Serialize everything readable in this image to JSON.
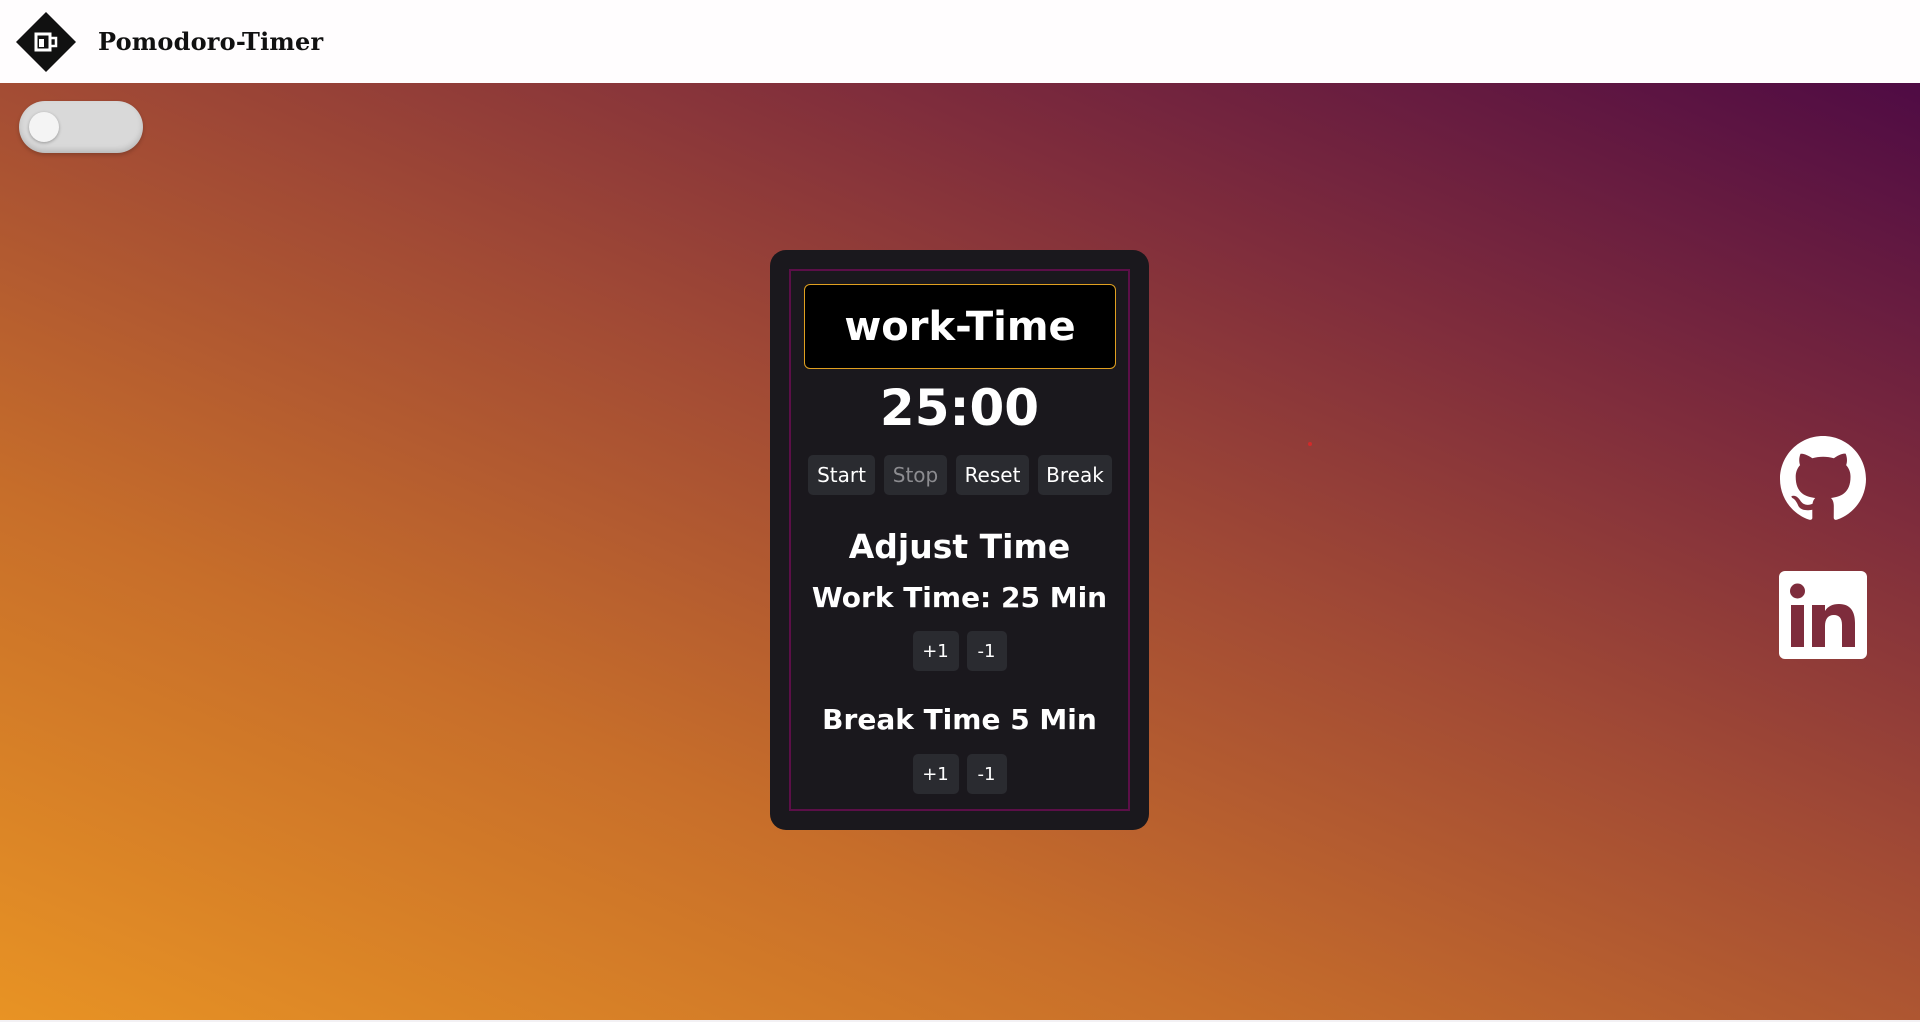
{
  "header": {
    "title": "Pomodoro-Timer",
    "logo_icon": "coffee-cup-diamond-icon"
  },
  "theme_toggle": {
    "state": "off"
  },
  "timer": {
    "mode_label": "work-Time",
    "display": "25:00",
    "controls": {
      "start": "Start",
      "stop": "Stop",
      "reset": "Reset",
      "break": "Break"
    }
  },
  "adjust": {
    "title": "Adjust Time",
    "work_label": "Work Time: 25 Min",
    "break_label": "Break Time 5 Min",
    "increment": "+1",
    "decrement": "-1"
  },
  "social": {
    "github_icon": "github-icon",
    "linkedin_icon": "linkedin-icon"
  },
  "colors": {
    "card_bg": "#1a181d",
    "card_border": "#5c0f48",
    "mode_border": "#e0a020",
    "button_bg": "#2a2b30",
    "gradient_start": "#e89324",
    "gradient_end": "#4f0b44"
  }
}
